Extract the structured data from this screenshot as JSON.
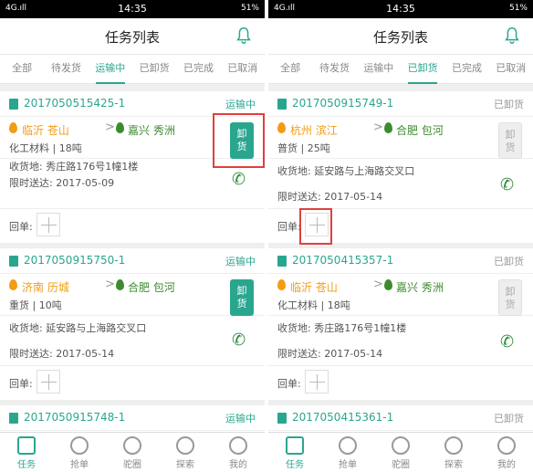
{
  "status": {
    "network": "4G.ıll",
    "time": "14:35",
    "battery": "51%"
  },
  "header": {
    "title": "任务列表",
    "icon": "bell-icon"
  },
  "tabs": [
    "全部",
    "待发货",
    "运输中",
    "已卸货",
    "已完成",
    "已取消"
  ],
  "left": {
    "active_tab": 2,
    "cards": [
      {
        "no": "2017050515425-1",
        "status": "运输中",
        "from": "临沂 苍山",
        "to": "嘉兴 秀洲",
        "cargo": "化工材料 | 18吨",
        "address": "收货地: 秀庄路176号1幢1楼",
        "deadline": "限时送达: 2017-05-09",
        "receipt": "回单:",
        "unload": "卸货"
      },
      {
        "no": "2017050915750-1",
        "status": "运输中",
        "from": "济南 历城",
        "to": "合肥 包河",
        "cargo": "重货 | 10吨",
        "address": "收货地: 延安路与上海路交叉口",
        "deadline": "限时送达: 2017-05-14",
        "receipt": "回单:",
        "unload": "卸货"
      },
      {
        "no": "2017050915748-1",
        "status": "运输中"
      }
    ]
  },
  "right": {
    "active_tab": 3,
    "cards": [
      {
        "no": "2017050915749-1",
        "status": "已卸货",
        "from": "杭州 滨江",
        "to": "合肥 包河",
        "cargo": "普货 | 25吨",
        "address": "收货地: 延安路与上海路交叉口",
        "deadline": "限时送达: 2017-05-14",
        "receipt": "回单:",
        "unload": "卸货"
      },
      {
        "no": "2017050415357-1",
        "status": "已卸货",
        "from": "临沂 苍山",
        "to": "嘉兴 秀洲",
        "cargo": "化工材料 | 18吨",
        "address": "收货地: 秀庄路176号1幢1楼",
        "deadline": "限时送达: 2017-05-14",
        "receipt": "回单:",
        "unload": "卸货"
      },
      {
        "no": "2017050415361-1",
        "status": "已卸货"
      }
    ]
  },
  "bottom_nav": [
    "任务",
    "抢单",
    "驼圈",
    "探索",
    "我的"
  ],
  "colors": {
    "accent": "#2aa68f",
    "origin": "#f39c12",
    "destination": "#3c8c2f",
    "highlight": "#e0403c"
  }
}
